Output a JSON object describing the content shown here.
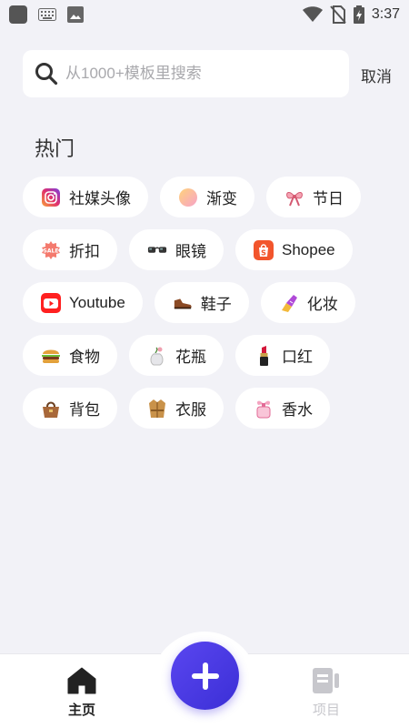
{
  "status_bar": {
    "time": "3:37",
    "icons": [
      "app-square-icon",
      "keyboard-icon",
      "image-icon",
      "wifi-icon",
      "no-sim-icon",
      "battery-charging-icon"
    ]
  },
  "search": {
    "placeholder": "从1000+模板里搜索",
    "value": "",
    "cancel_label": "取消"
  },
  "hot_section": {
    "title": "热门",
    "rows": [
      [
        {
          "label": "社媒头像",
          "icon": "instagram-icon"
        },
        {
          "label": "渐变",
          "icon": "gradient-circle-icon"
        },
        {
          "label": "节日",
          "icon": "festival-bow-icon"
        }
      ],
      [
        {
          "label": "折扣",
          "icon": "sale-tag-icon"
        },
        {
          "label": "眼镜",
          "icon": "glasses-icon"
        },
        {
          "label": "Shopee",
          "icon": "shopee-icon"
        }
      ],
      [
        {
          "label": "Youtube",
          "icon": "youtube-icon"
        },
        {
          "label": "鞋子",
          "icon": "shoe-icon"
        },
        {
          "label": "化妆",
          "icon": "nail-polish-icon"
        }
      ],
      [
        {
          "label": "食物",
          "icon": "burger-icon"
        },
        {
          "label": "花瓶",
          "icon": "vase-icon"
        },
        {
          "label": "口红",
          "icon": "lipstick-icon"
        }
      ],
      [
        {
          "label": "背包",
          "icon": "handbag-icon"
        },
        {
          "label": "衣服",
          "icon": "coat-icon"
        },
        {
          "label": "香水",
          "icon": "perfume-icon"
        }
      ]
    ]
  },
  "bottom_nav": {
    "home_label": "主页",
    "projects_label": "项目",
    "active": "home"
  },
  "colors": {
    "accent": "#4a3ce6",
    "background": "#f2f2f7"
  }
}
